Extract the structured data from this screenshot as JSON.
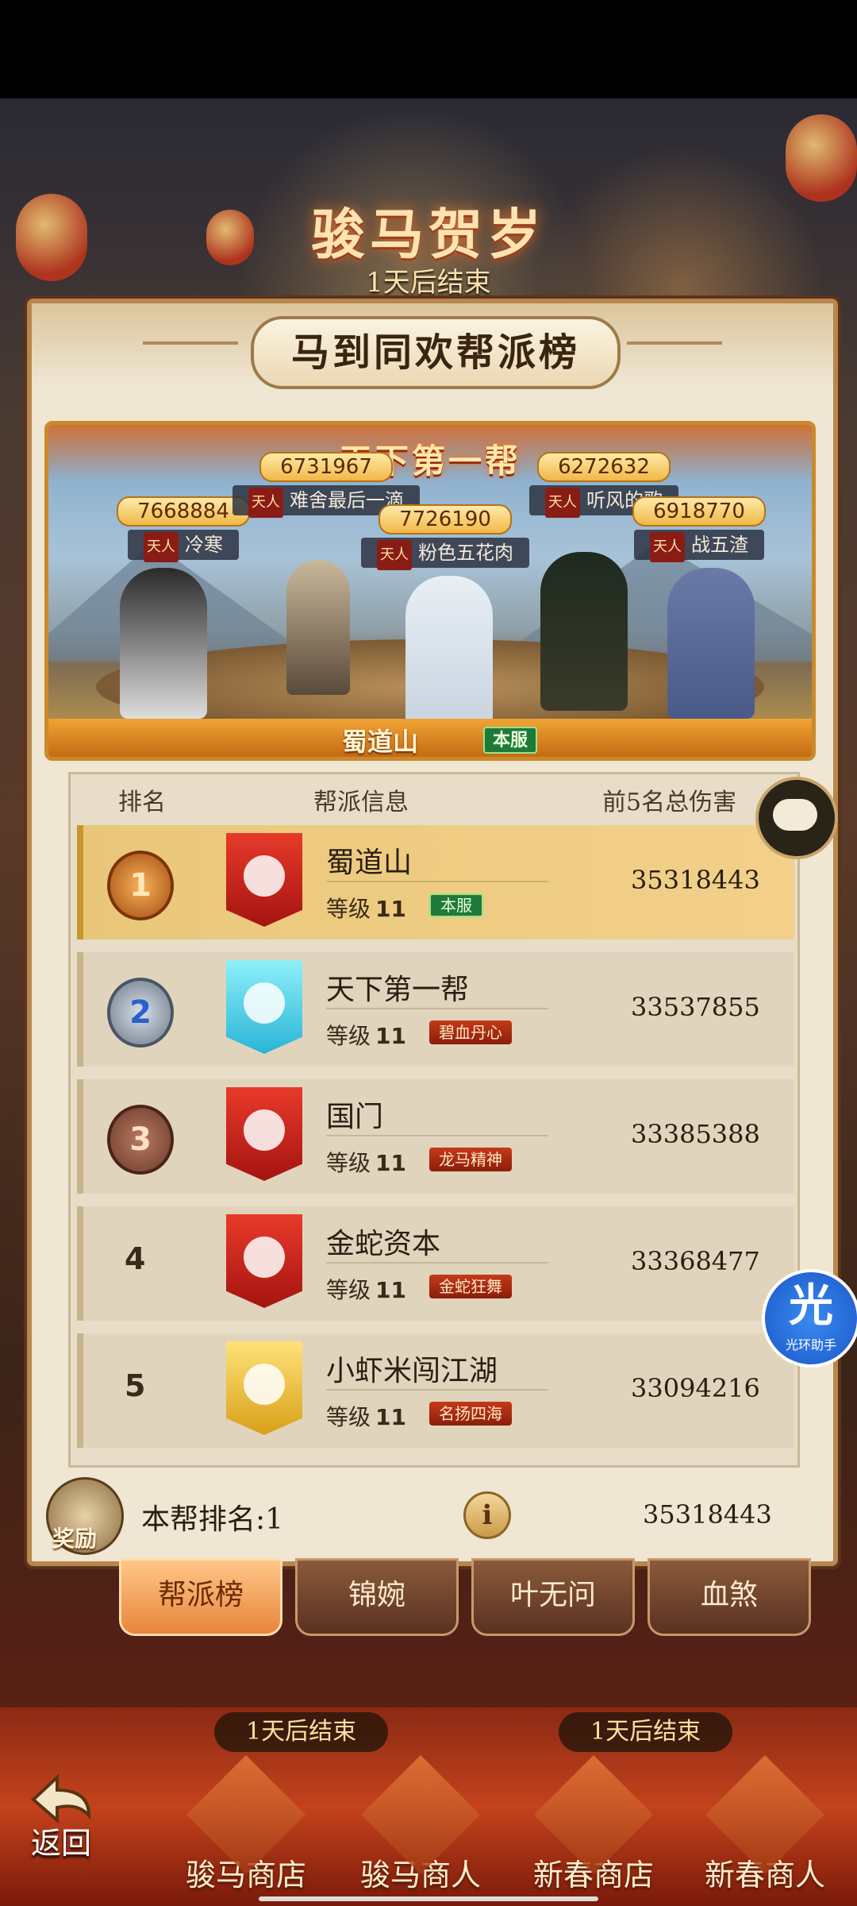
{
  "event": {
    "title": "骏马贺岁",
    "timer": "1天后结束"
  },
  "panel": {
    "title": "马到同欢帮派榜"
  },
  "banner": {
    "title": "天下第一帮",
    "guild_name": "蜀道山",
    "server_tag": "本服",
    "members": [
      {
        "score": "7668884",
        "tier": "天人",
        "name": "冷寒"
      },
      {
        "score": "6731967",
        "tier": "天人",
        "name": "难舍最后一滴"
      },
      {
        "score": "7726190",
        "tier": "天人",
        "name": "粉色五花肉"
      },
      {
        "score": "6272632",
        "tier": "天人",
        "name": "听风的歌"
      },
      {
        "score": "6918770",
        "tier": "天人",
        "name": "战五渣"
      }
    ]
  },
  "table": {
    "headers": {
      "rank": "排名",
      "info": "帮派信息",
      "damage": "前5名总伤害"
    },
    "level_label": "等级",
    "rows": [
      {
        "rank": "1",
        "name": "蜀道山",
        "level": "11",
        "tag": "本服",
        "damage": "35318443",
        "emblem": "red-phoenix"
      },
      {
        "rank": "2",
        "name": "天下第一帮",
        "level": "11",
        "tag": "碧血丹心",
        "damage": "33537855",
        "emblem": "cyan-dragon"
      },
      {
        "rank": "3",
        "name": "国门",
        "level": "11",
        "tag": "龙马精神",
        "damage": "33385388",
        "emblem": "red-flame"
      },
      {
        "rank": "4",
        "name": "金蛇资本",
        "level": "11",
        "tag": "金蛇狂舞",
        "damage": "33368477",
        "emblem": "red-dragon"
      },
      {
        "rank": "5",
        "name": "小虾米闯江湖",
        "level": "11",
        "tag": "名扬四海",
        "damage": "33094216",
        "emblem": "gold-dragon"
      }
    ]
  },
  "my_rank": {
    "reward_label": "奖励",
    "text": "本帮排名:1",
    "damage": "35318443"
  },
  "tabs": [
    "帮派榜",
    "锦婉",
    "叶无问",
    "血煞"
  ],
  "helper": {
    "glyph": "光",
    "label": "光环助手"
  },
  "bottom": {
    "timers": [
      "1天后结束",
      "1天后结束"
    ],
    "back": "返回",
    "shops": [
      "骏马商店",
      "骏马商人",
      "新春商店",
      "新春商人"
    ]
  },
  "colors": {
    "accent": "#e8853a",
    "panel": "#efe6d3",
    "gold": "#f0b847",
    "server_green": "#1f7a3a"
  }
}
